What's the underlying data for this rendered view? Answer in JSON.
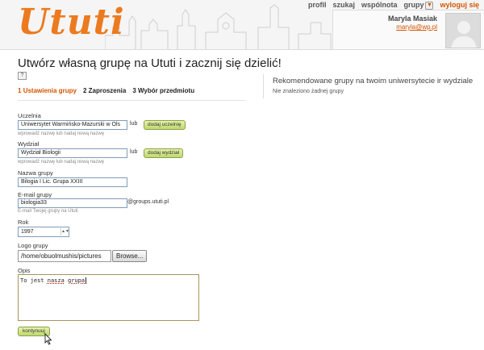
{
  "header": {
    "logo": "Ututi",
    "nav": {
      "profile": "profil",
      "search": "szukaj",
      "community": "wspólnota",
      "groups": "grupy",
      "logout": "wyloguj się"
    },
    "user": {
      "name": "Maryla Masiak",
      "email": "maryla@wp.pl"
    }
  },
  "page": {
    "title": "Utwórz własną grupę na Ututi i zacznij się dzielić!",
    "help": "?",
    "steps": [
      {
        "num": "1",
        "label": "Ustawienia grupy"
      },
      {
        "num": "2",
        "label": "Zaproszenia"
      },
      {
        "num": "3",
        "label": "Wybór przedmiotu"
      }
    ]
  },
  "recommend": {
    "title": "Rekomendowane grupy na twoim uniwersytecie ir wydziale",
    "empty": "Nie znaleziono żadnej grupy"
  },
  "form": {
    "university": {
      "label": "Uczelnia",
      "value": "Uniwersytet Warmińsko-Mazurski w Ols",
      "or": "lub",
      "button": "dodaj uczelnię",
      "hint": "wprowadź nazwę lub nadaj nową nazwę"
    },
    "department": {
      "label": "Wydział",
      "value": "Wydział Biologii",
      "or": "lub",
      "button": "dodaj wydział",
      "hint": "wprowadź nazwę lub nadaj nową nazwę"
    },
    "group_name": {
      "label": "Nazwa grupy",
      "value": "Bilogia I Lic. Grupa XXIII"
    },
    "email": {
      "label": "E-mail grupy",
      "value": "biologia33",
      "suffix": "@groups.ututi.pl",
      "hint": "E-mail Twojej grupy na Ututi"
    },
    "year": {
      "label": "Rok",
      "value": "1997"
    },
    "logo": {
      "label": "Logo grupy",
      "value": "/home/obuolmushis/pictures",
      "browse": "Browse..."
    },
    "description": {
      "label": "Opis",
      "word1": "To",
      "word2": "jest",
      "word3": "nasza",
      "word4": "grupa"
    },
    "submit": "kontynuuj"
  }
}
